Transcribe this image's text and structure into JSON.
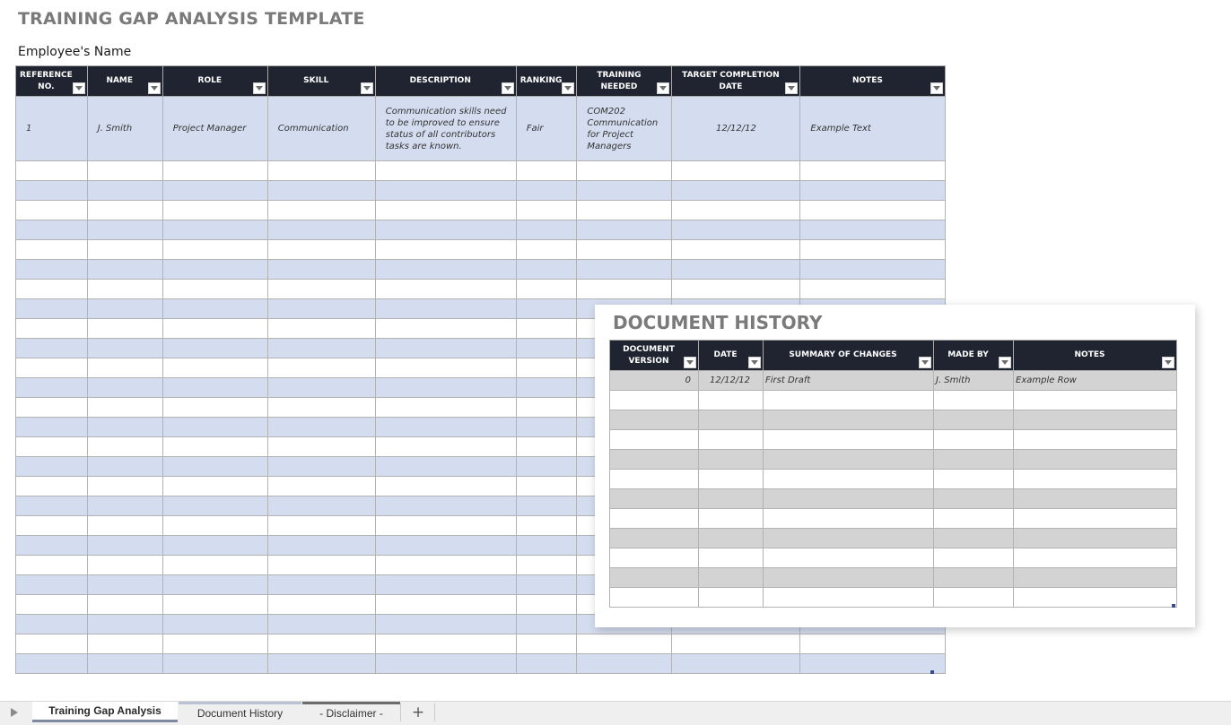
{
  "title": "TRAINING GAP ANALYSIS TEMPLATE",
  "employee_label": "Employee's Name",
  "main_table": {
    "columns": [
      {
        "label": "REFERENCE NO.",
        "width": 69
      },
      {
        "label": "NAME",
        "width": 84
      },
      {
        "label": "ROLE",
        "width": 117
      },
      {
        "label": "SKILL",
        "width": 120
      },
      {
        "label": "DESCRIPTION",
        "width": 157
      },
      {
        "label": "RANKING",
        "width": 66
      },
      {
        "label": "TRAINING NEEDED",
        "width": 106
      },
      {
        "label": "TARGET COMPLETION DATE",
        "width": 143
      },
      {
        "label": "NOTES",
        "width": 162
      }
    ],
    "rows": [
      [
        "1",
        "J. Smith",
        "Project Manager",
        "Communication",
        "Communication skills need to be improved to ensure status of all contributors tasks are known.",
        "Fair",
        "COM202 Communication for Project Managers",
        "12/12/12",
        "Example Text"
      ]
    ],
    "empty_row_count": 26,
    "colors": {
      "header_bg": "#1f2430",
      "band": "#d4ddef"
    }
  },
  "document_history": {
    "title": "DOCUMENT HISTORY",
    "columns": [
      {
        "label": "DOCUMENT VERSION"
      },
      {
        "label": "DATE"
      },
      {
        "label": "SUMMARY OF CHANGES"
      },
      {
        "label": "MADE BY"
      },
      {
        "label": "NOTES"
      }
    ],
    "rows": [
      [
        "0",
        "12/12/12",
        "First Draft",
        "J. Smith",
        "Example Row"
      ]
    ],
    "empty_row_count": 11,
    "colors": {
      "band": "#d3d3d3"
    }
  },
  "sheet_tabs": [
    {
      "label": "Training Gap Analysis",
      "active": true
    },
    {
      "label": "Document History",
      "active": false
    },
    {
      "label": "- Disclaimer -",
      "active": false
    }
  ],
  "add_sheet_label": "+"
}
